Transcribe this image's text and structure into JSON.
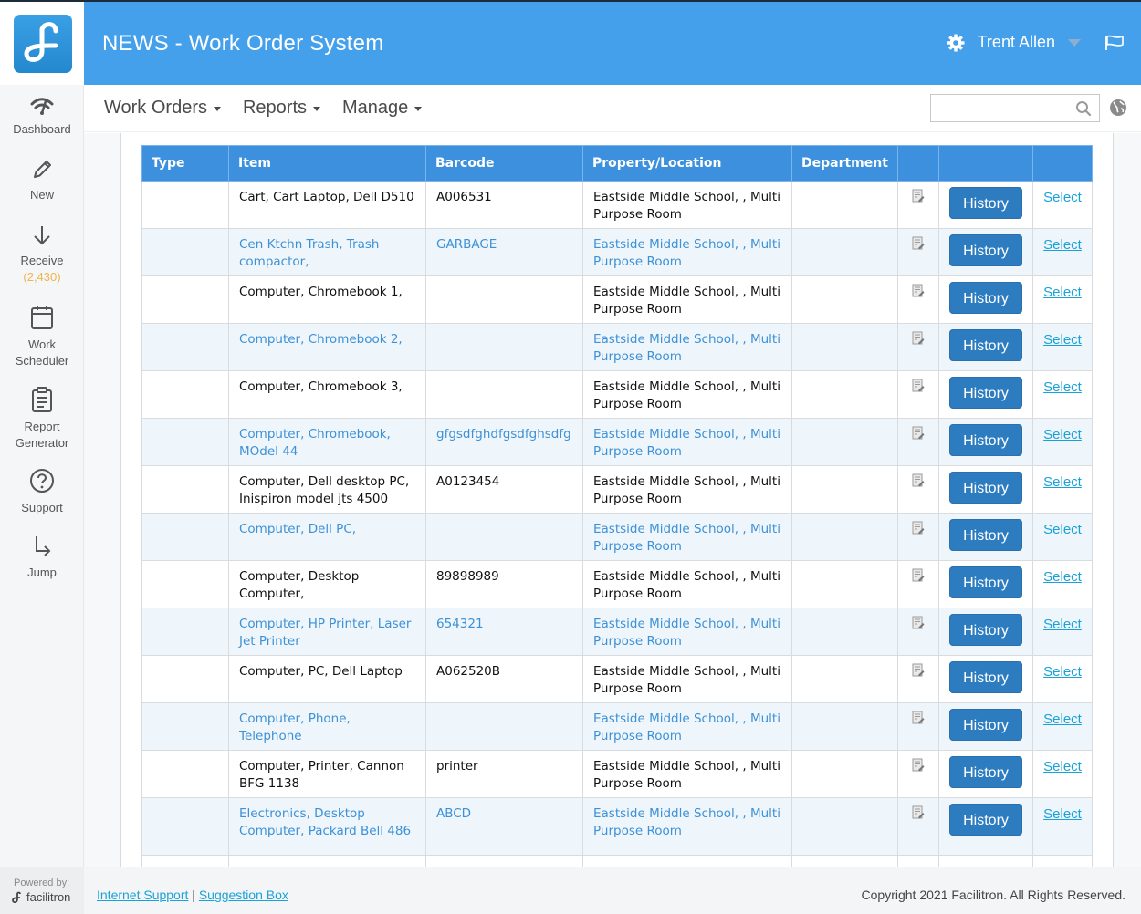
{
  "header": {
    "app_title": "NEWS - Work Order System",
    "user_name": "Trent Allen",
    "icons": [
      "facilitron-logo-icon",
      "gear-icon",
      "caret-down-icon",
      "flag-icon"
    ]
  },
  "sidebar": {
    "items": [
      {
        "label": "Dashboard",
        "icon": "dashboard-icon"
      },
      {
        "label": "New",
        "icon": "pencil-icon"
      },
      {
        "label": "Receive",
        "count": "(2,430)",
        "icon": "arrow-down-icon"
      },
      {
        "label_line1": "Work",
        "label_line2": "Scheduler",
        "icon": "calendar-icon"
      },
      {
        "label_line1": "Report",
        "label_line2": "Generator",
        "icon": "clipboard-icon"
      },
      {
        "label": "Support",
        "icon": "question-circle-icon"
      },
      {
        "label": "Jump",
        "icon": "jump-arrow-icon"
      }
    ]
  },
  "navbar": {
    "menus": [
      {
        "label": "Work Orders"
      },
      {
        "label": "Reports"
      },
      {
        "label": "Manage"
      }
    ],
    "search": {
      "value": "",
      "placeholder": ""
    }
  },
  "table": {
    "columns": [
      "Type",
      "Item",
      "Barcode",
      "Property/Location",
      "Department",
      "",
      "",
      ""
    ],
    "history_label": "History",
    "select_label": "Select",
    "rows": [
      {
        "type": "",
        "item": "Cart, Cart Laptop, Dell D510",
        "barcode": "A006531",
        "location": "Eastside Middle School, , Multi Purpose Room",
        "department": ""
      },
      {
        "type": "",
        "item": "Cen Ktchn Trash, Trash compactor,",
        "barcode": "GARBAGE",
        "location": "Eastside Middle School, , Multi Purpose Room",
        "department": ""
      },
      {
        "type": "",
        "item": "Computer, Chromebook 1,",
        "barcode": "",
        "location": "Eastside Middle School, , Multi Purpose Room",
        "department": ""
      },
      {
        "type": "",
        "item": "Computer, Chromebook 2,",
        "barcode": "",
        "location": "Eastside Middle School, , Multi Purpose Room",
        "department": ""
      },
      {
        "type": "",
        "item": "Computer, Chromebook 3,",
        "barcode": "",
        "location": "Eastside Middle School, , Multi Purpose Room",
        "department": ""
      },
      {
        "type": "",
        "item": "Computer, Chromebook, MOdel 44",
        "barcode": "gfgsdfghdfgsdfghsdfg",
        "location": "Eastside Middle School, , Multi Purpose Room",
        "department": ""
      },
      {
        "type": "",
        "item": "Computer, Dell desktop PC, Inispiron model jts 4500",
        "barcode": "A0123454",
        "location": "Eastside Middle School, , Multi Purpose Room",
        "department": ""
      },
      {
        "type": "",
        "item": "Computer, Dell PC,",
        "barcode": "",
        "location": "Eastside Middle School, , Multi Purpose Room",
        "department": ""
      },
      {
        "type": "",
        "item": "Computer, Desktop Computer,",
        "barcode": "89898989",
        "location": "Eastside Middle School, , Multi Purpose Room",
        "department": ""
      },
      {
        "type": "",
        "item": "Computer, HP Printer, Laser Jet Printer",
        "barcode": "654321",
        "location": "Eastside Middle School, , Multi Purpose Room",
        "department": ""
      },
      {
        "type": "",
        "item": "Computer, PC, Dell Laptop",
        "barcode": "A062520B",
        "location": "Eastside Middle School, , Multi Purpose Room",
        "department": ""
      },
      {
        "type": "",
        "item": "Computer, Phone, Telephone",
        "barcode": "",
        "location": "Eastside Middle School, , Multi Purpose Room",
        "department": ""
      },
      {
        "type": "",
        "item": "Computer, Printer, Cannon BFG 1138",
        "barcode": "printer",
        "location": "Eastside Middle School, , Multi Purpose Room",
        "department": ""
      },
      {
        "type": "",
        "item": "Electronics, Desktop Computer, Packard Bell 486",
        "barcode": "ABCD",
        "location": "Eastside Middle School, , Multi Purpose Room",
        "department": ""
      }
    ]
  },
  "footer": {
    "powered_by": "Powered by:",
    "brand": "facilitron",
    "links": [
      "Internet Support",
      "Suggestion Box"
    ],
    "separator": "|",
    "copyright": "Copyright 2021 Facilitron. All Rights Reserved."
  },
  "colors": {
    "header_blue": "#45a0ec",
    "table_header_blue": "#3c90dd",
    "button_blue": "#2e7cc0",
    "link_cyan": "#1aa2d8",
    "alt_row_text": "#3d91d6",
    "count_orange": "#f0b44c"
  }
}
